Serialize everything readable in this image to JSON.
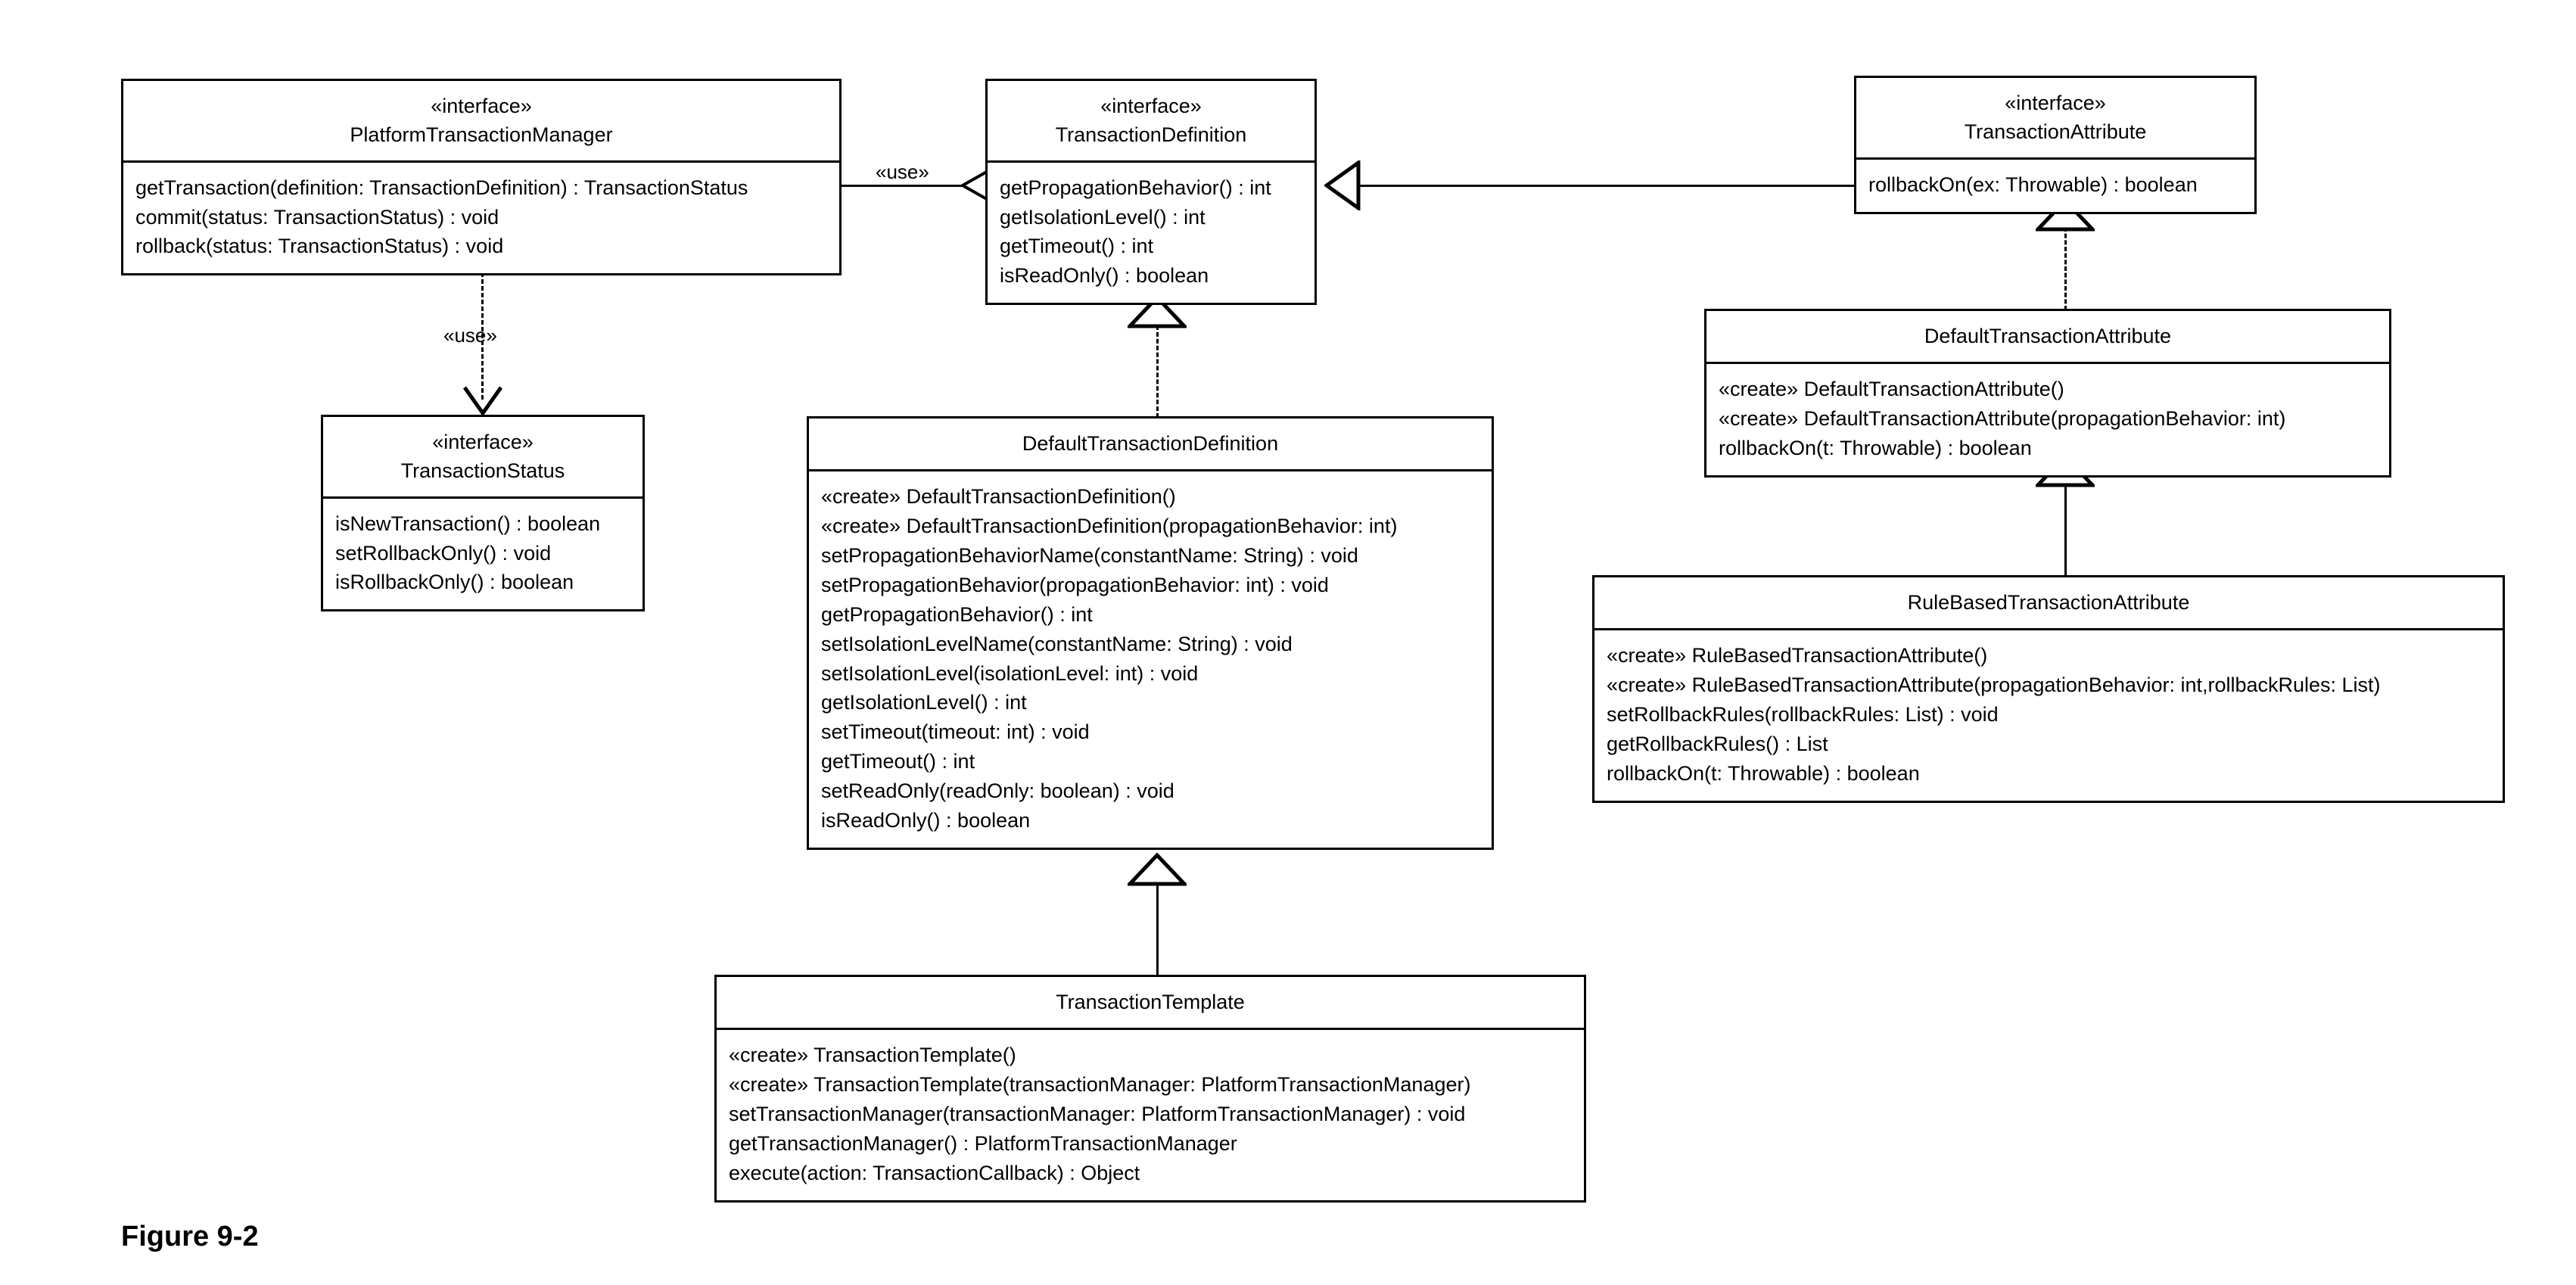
{
  "figure": {
    "caption": "Figure 9-2"
  },
  "classes": {
    "platform_transaction_manager": {
      "stereotype": "«interface»",
      "name": "PlatformTransactionManager",
      "members": [
        "getTransaction(definition: TransactionDefinition) : TransactionStatus",
        "commit(status: TransactionStatus) : void",
        "rollback(status: TransactionStatus) : void"
      ]
    },
    "transaction_definition": {
      "stereotype": "«interface»",
      "name": "TransactionDefinition",
      "members": [
        "getPropagationBehavior() : int",
        "getIsolationLevel() : int",
        "getTimeout() : int",
        "isReadOnly() : boolean"
      ]
    },
    "transaction_attribute": {
      "stereotype": "«interface»",
      "name": "TransactionAttribute",
      "members": [
        "rollbackOn(ex: Throwable) : boolean"
      ]
    },
    "transaction_status": {
      "stereotype": "«interface»",
      "name": "TransactionStatus",
      "members": [
        "isNewTransaction() : boolean",
        "setRollbackOnly() : void",
        "isRollbackOnly() : boolean"
      ]
    },
    "default_transaction_definition": {
      "stereotype": "",
      "name": "DefaultTransactionDefinition",
      "members": [
        "«create» DefaultTransactionDefinition()",
        "«create» DefaultTransactionDefinition(propagationBehavior: int)",
        "setPropagationBehaviorName(constantName: String) : void",
        "setPropagationBehavior(propagationBehavior: int) : void",
        "getPropagationBehavior() : int",
        "setIsolationLevelName(constantName: String) : void",
        "setIsolationLevel(isolationLevel: int) : void",
        "getIsolationLevel() : int",
        "setTimeout(timeout: int) : void",
        "getTimeout() : int",
        "setReadOnly(readOnly: boolean) : void",
        "isReadOnly() : boolean"
      ]
    },
    "default_transaction_attribute": {
      "stereotype": "",
      "name": "DefaultTransactionAttribute",
      "members": [
        "«create» DefaultTransactionAttribute()",
        "«create» DefaultTransactionAttribute(propagationBehavior: int)",
        "rollbackOn(t: Throwable) : boolean"
      ]
    },
    "rule_based_transaction_attribute": {
      "stereotype": "",
      "name": "RuleBasedTransactionAttribute",
      "members": [
        "«create» RuleBasedTransactionAttribute()",
        "«create» RuleBasedTransactionAttribute(propagationBehavior: int,rollbackRules: List)",
        "setRollbackRules(rollbackRules: List) : void",
        "getRollbackRules() : List",
        "rollbackOn(t: Throwable) : boolean"
      ]
    },
    "transaction_template": {
      "stereotype": "",
      "name": "TransactionTemplate",
      "members": [
        "«create» TransactionTemplate()",
        "«create» TransactionTemplate(transactionManager: PlatformTransactionManager)",
        "setTransactionManager(transactionManager: PlatformTransactionManager) : void",
        "getTransactionManager() : PlatformTransactionManager",
        "execute(action: TransactionCallback) : Object"
      ]
    }
  },
  "relationships": {
    "manager_uses_definition": {
      "label": "«use»",
      "kind": "dependency-solid-open-arrow",
      "from": "PlatformTransactionManager",
      "to": "TransactionDefinition"
    },
    "manager_uses_status": {
      "label": "«use»",
      "kind": "dependency-dashed-vee",
      "from": "PlatformTransactionManager",
      "to": "TransactionStatus"
    },
    "attribute_extends_definition": {
      "label": "",
      "kind": "generalization-solid-hollow-triangle",
      "from": "TransactionAttribute",
      "to": "TransactionDefinition"
    },
    "defaultdef_realizes_definition": {
      "label": "",
      "kind": "realization-dashed-hollow-triangle",
      "from": "DefaultTransactionDefinition",
      "to": "TransactionDefinition"
    },
    "defaultattr_realizes_attribute": {
      "label": "",
      "kind": "realization-dashed-hollow-triangle",
      "from": "DefaultTransactionAttribute",
      "to": "TransactionAttribute"
    },
    "rulebased_extends_defaultattr": {
      "label": "",
      "kind": "generalization-solid-hollow-triangle",
      "from": "RuleBasedTransactionAttribute",
      "to": "DefaultTransactionAttribute"
    },
    "template_extends_defaultdef": {
      "label": "",
      "kind": "generalization-solid-hollow-triangle",
      "from": "TransactionTemplate",
      "to": "DefaultTransactionDefinition"
    }
  }
}
